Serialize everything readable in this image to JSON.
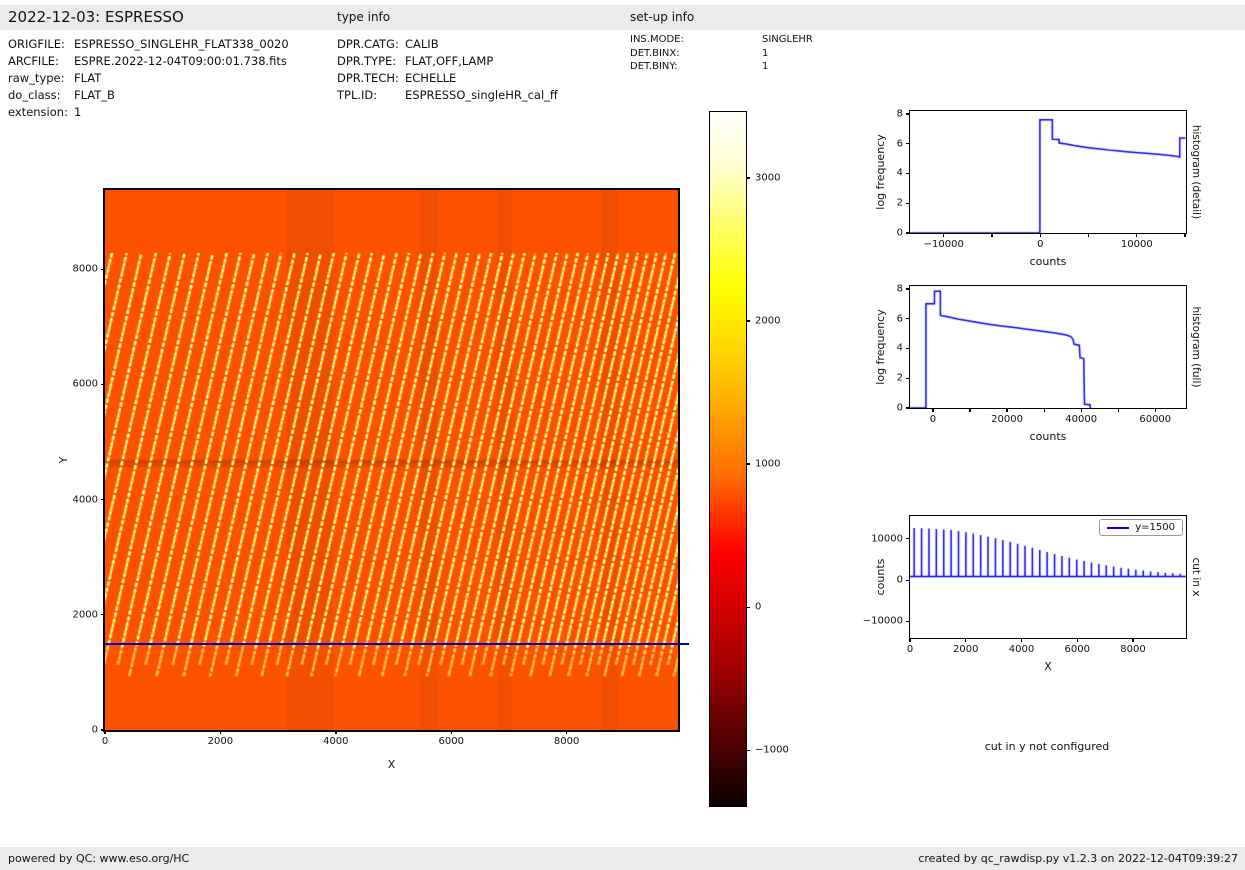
{
  "header": {
    "title": "2022-12-03: ESPRESSO",
    "type_info_title": "type info",
    "setup_info_title": "set-up info",
    "left_rows": [
      {
        "label": "ORIGFILE:",
        "value": "ESPRESSO_SINGLEHR_FLAT338_0020"
      },
      {
        "label": "ARCFILE:",
        "value": "ESPRE.2022-12-04T09:00:01.738.fits"
      },
      {
        "label": "raw_type:",
        "value": "FLAT"
      },
      {
        "label": "do_class:",
        "value": "FLAT_B"
      },
      {
        "label": "extension:",
        "value": "1"
      }
    ],
    "type_rows": [
      {
        "label": "DPR.CATG:",
        "value": "CALIB"
      },
      {
        "label": "DPR.TYPE:",
        "value": "FLAT,OFF,LAMP"
      },
      {
        "label": "DPR.TECH:",
        "value": "ECHELLE"
      },
      {
        "label": "TPL.ID:",
        "value": "ESPRESSO_singleHR_cal_ff"
      }
    ],
    "setup_rows": [
      {
        "label": "INS.MODE:",
        "value": "SINGLEHR"
      },
      {
        "label": "DET.BINX:",
        "value": "1"
      },
      {
        "label": "DET.BINY:",
        "value": "1"
      }
    ]
  },
  "footer": {
    "left": "powered by QC: www.eso.org/HC",
    "right": "created by qc_rawdisp.py v1.2.3 on 2022-12-04T09:39:27"
  },
  "no_cut_y_text": "cut in y not configured",
  "colors": {
    "line_blue": "#0000ee",
    "cut_line_blue": "#0000cc",
    "heatmap_orange": "#fc5200",
    "stripe_white": "#ffffff",
    "stripe_yellow": "#ffcf00",
    "strip_gray": "#ebebeb"
  },
  "chart_data": [
    {
      "id": "raw-frame-image",
      "type": "heatmap",
      "xlabel": "X",
      "ylabel": "Y",
      "xlim": [
        0,
        9930
      ],
      "ylim": [
        0,
        9375
      ],
      "xticks": [
        0,
        2000,
        4000,
        6000,
        8000
      ],
      "yticks": [
        0,
        2000,
        4000,
        6000,
        8000
      ],
      "colormap": "hot",
      "description": "ESPRESSO raw echelle flat: ~50 slanted white/yellow order stripes on orange background between y=950 and y=8280, plain orange above and below, blue cut line at y=1500",
      "cut_line": {
        "y": 1500
      },
      "render": {
        "bg": "#fc5200",
        "stripe_top_y": 8280,
        "stripe_bottom_y_a": 950,
        "stripe_bottom_y_b": 1150,
        "slope_dx_per_dy": -0.23,
        "first_top_x": 120,
        "top_spacing_start": 256,
        "top_spacing_min": 150,
        "top_spacing_step": 2.1,
        "dark_vbands": [
          [
            3150,
            3950
          ],
          [
            5450,
            5750
          ],
          [
            6800,
            7050
          ],
          [
            8600,
            8900
          ]
        ],
        "dark_hband": [
          4560,
          4700
        ],
        "fade_band": [
          950,
          1430
        ]
      },
      "colorbar": {
        "vmin": -1390,
        "vmax": 3460,
        "ticks": [
          3000,
          2000,
          1000,
          0,
          -1000
        ]
      }
    },
    {
      "id": "histogram-detail",
      "type": "line",
      "xlabel": "counts",
      "ylabel": "log frequency",
      "right_label": "histogram (detail)",
      "xlim": [
        -13500,
        15100
      ],
      "ylim": [
        0,
        8.2
      ],
      "xticks": [
        -10000,
        0,
        10000
      ],
      "xticks_minor": [
        -5000,
        5000,
        15000
      ],
      "yticks": [
        0,
        2,
        4,
        6,
        8
      ],
      "points": [
        [
          -13500,
          0
        ],
        [
          -40,
          0
        ],
        [
          -40,
          7.62
        ],
        [
          1250,
          7.62
        ],
        [
          1250,
          6.3
        ],
        [
          1950,
          6.28
        ],
        [
          1950,
          6.05
        ],
        [
          2700,
          5.98
        ],
        [
          3500,
          5.88
        ],
        [
          4300,
          5.8
        ],
        [
          5200,
          5.72
        ],
        [
          6200,
          5.64
        ],
        [
          7200,
          5.57
        ],
        [
          8200,
          5.51
        ],
        [
          9200,
          5.45
        ],
        [
          10200,
          5.39
        ],
        [
          11200,
          5.34
        ],
        [
          12200,
          5.29
        ],
        [
          13200,
          5.23
        ],
        [
          14100,
          5.16
        ],
        [
          14450,
          5.1
        ],
        [
          14450,
          6.38
        ],
        [
          15050,
          6.38
        ]
      ]
    },
    {
      "id": "histogram-full",
      "type": "line",
      "xlabel": "counts",
      "ylabel": "log frequency",
      "right_label": "histogram (full)",
      "xlim": [
        -6200,
        68300
      ],
      "ylim": [
        0,
        8.2
      ],
      "xticks": [
        0,
        20000,
        40000,
        60000
      ],
      "xticks_minor": [
        10000,
        30000,
        50000
      ],
      "yticks": [
        0,
        2,
        4,
        6,
        8
      ],
      "points": [
        [
          -6150,
          0
        ],
        [
          -1900,
          0
        ],
        [
          -1900,
          7.0
        ],
        [
          400,
          7.0
        ],
        [
          400,
          7.85
        ],
        [
          2000,
          7.85
        ],
        [
          2000,
          6.22
        ],
        [
          3600,
          6.15
        ],
        [
          5200,
          6.07
        ],
        [
          7000,
          5.97
        ],
        [
          9000,
          5.88
        ],
        [
          11000,
          5.79
        ],
        [
          13000,
          5.71
        ],
        [
          15000,
          5.63
        ],
        [
          17000,
          5.56
        ],
        [
          19000,
          5.5
        ],
        [
          21000,
          5.44
        ],
        [
          23000,
          5.38
        ],
        [
          25000,
          5.31
        ],
        [
          27000,
          5.25
        ],
        [
          29000,
          5.18
        ],
        [
          31000,
          5.11
        ],
        [
          33000,
          5.04
        ],
        [
          34500,
          4.98
        ],
        [
          36000,
          4.9
        ],
        [
          37200,
          4.8
        ],
        [
          37800,
          4.62
        ],
        [
          38100,
          4.28
        ],
        [
          39500,
          4.22
        ],
        [
          39700,
          3.38
        ],
        [
          40700,
          3.32
        ],
        [
          40900,
          0.25
        ],
        [
          42400,
          0.22
        ],
        [
          42500,
          0
        ]
      ]
    },
    {
      "id": "cut-in-x",
      "type": "line",
      "xlabel": "X",
      "ylabel": "counts",
      "right_label": "cut in x",
      "legend": "y=1500",
      "xlim": [
        0,
        9900
      ],
      "ylim": [
        -14000,
        15500
      ],
      "xticks": [
        0,
        2000,
        4000,
        6000,
        8000
      ],
      "yticks": [
        -10000,
        0,
        10000
      ],
      "baseline": 900,
      "spikes": [
        [
          150,
          12600
        ],
        [
          415,
          12550
        ],
        [
          680,
          12450
        ],
        [
          945,
          12350
        ],
        [
          1210,
          12250
        ],
        [
          1475,
          12100
        ],
        [
          1740,
          11900
        ],
        [
          2005,
          11600
        ],
        [
          2270,
          11250
        ],
        [
          2535,
          10900
        ],
        [
          2800,
          10500
        ],
        [
          3065,
          10100
        ],
        [
          3330,
          9700
        ],
        [
          3595,
          9250
        ],
        [
          3860,
          8800
        ],
        [
          4125,
          8300
        ],
        [
          4390,
          7800
        ],
        [
          4655,
          7300
        ],
        [
          4920,
          6800
        ],
        [
          5185,
          6300
        ],
        [
          5450,
          5850
        ],
        [
          5715,
          5400
        ],
        [
          5980,
          5000
        ],
        [
          6245,
          4600
        ],
        [
          6510,
          4250
        ],
        [
          6775,
          3900
        ],
        [
          7040,
          3600
        ],
        [
          7305,
          3300
        ],
        [
          7570,
          3000
        ],
        [
          7835,
          2750
        ],
        [
          8100,
          2500
        ],
        [
          8365,
          2300
        ],
        [
          8630,
          2100
        ],
        [
          8895,
          1950
        ],
        [
          9160,
          1800
        ],
        [
          9425,
          1650
        ],
        [
          9690,
          1550
        ]
      ]
    }
  ]
}
